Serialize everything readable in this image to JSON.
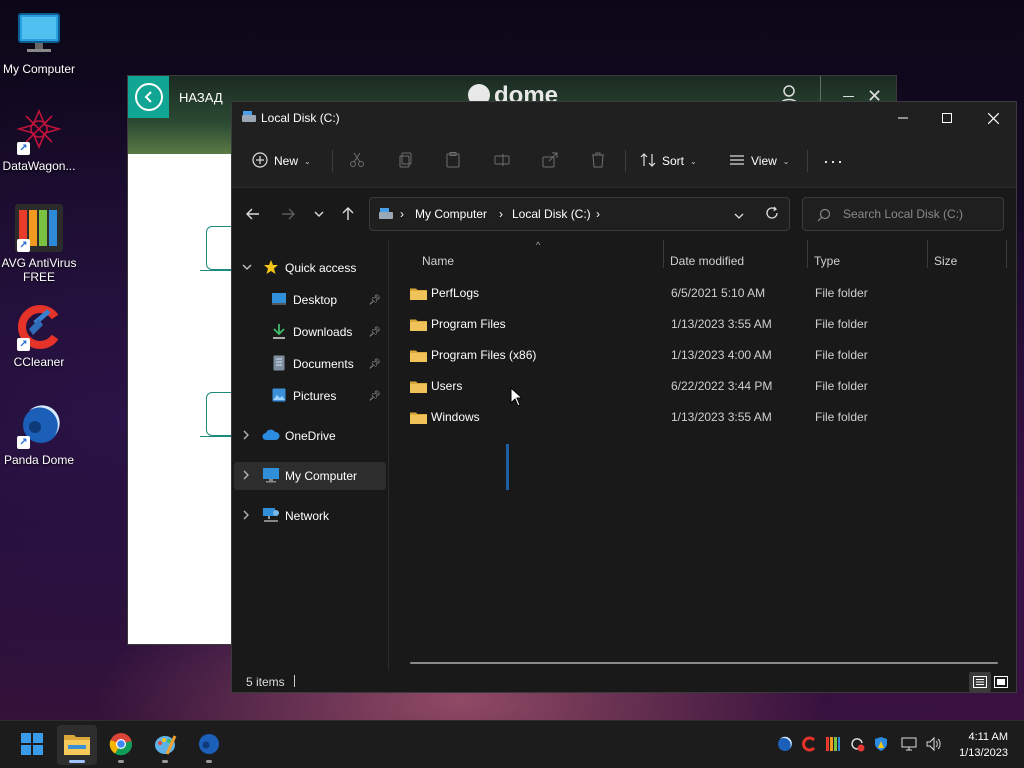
{
  "desktop": {
    "icons": [
      {
        "label": "My Computer"
      },
      {
        "label": "DataWagon..."
      },
      {
        "label": "AVG AntiVirus FREE"
      },
      {
        "label": "CCleaner"
      },
      {
        "label": "Panda Dome"
      }
    ]
  },
  "dome": {
    "back_label": "НАЗАД",
    "logo": "dome"
  },
  "explorer": {
    "title": "Local Disk (C:)",
    "toolbar": {
      "new_label": "New",
      "sort_label": "Sort",
      "view_label": "View",
      "more_label": "···"
    },
    "breadcrumb": [
      "My Computer",
      "Local Disk (C:)"
    ],
    "search_placeholder": "Search Local Disk (C:)",
    "nav": {
      "quick_access": "Quick access",
      "desktop": "Desktop",
      "downloads": "Downloads",
      "documents": "Documents",
      "pictures": "Pictures",
      "onedrive": "OneDrive",
      "my_computer": "My Computer",
      "network": "Network"
    },
    "columns": {
      "name": "Name",
      "date": "Date modified",
      "type": "Type",
      "size": "Size"
    },
    "files": [
      {
        "name": "PerfLogs",
        "date": "6/5/2021 5:10 AM",
        "type": "File folder"
      },
      {
        "name": "Program Files",
        "date": "1/13/2023 3:55 AM",
        "type": "File folder"
      },
      {
        "name": "Program Files (x86)",
        "date": "1/13/2023 4:00 AM",
        "type": "File folder"
      },
      {
        "name": "Users",
        "date": "6/22/2022 3:44 PM",
        "type": "File folder"
      },
      {
        "name": "Windows",
        "date": "1/13/2023 3:55 AM",
        "type": "File folder"
      }
    ],
    "status": "5 items"
  },
  "taskbar": {
    "time": "4:11 AM",
    "date": "1/13/2023",
    "apps": [
      "start-icon",
      "file-explorer-icon",
      "chrome-icon",
      "paint-icon",
      "panda-dome-icon"
    ]
  },
  "colors": {
    "accent": "#0078d4",
    "folder": "#e8b84a",
    "dome_teal": "#11a594"
  }
}
